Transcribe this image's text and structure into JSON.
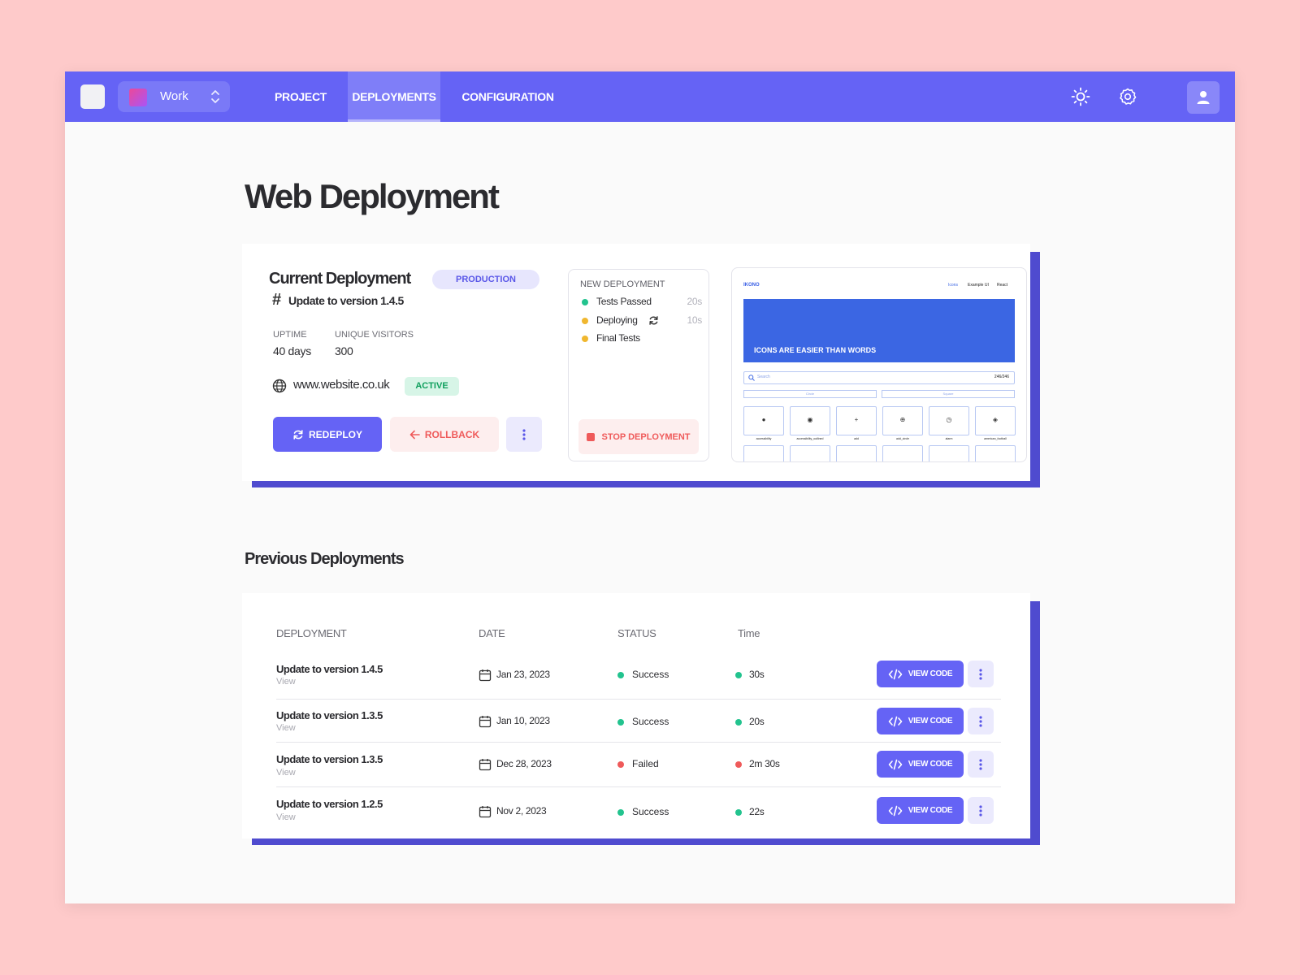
{
  "colors": {
    "accent": "#6563f5",
    "success": "#22c38e",
    "warning": "#f0b72f",
    "danger": "#ef5a5a",
    "background": "#fecaca"
  },
  "workspace": {
    "label": "Work"
  },
  "nav": {
    "tabs": [
      "PROJECT",
      "DEPLOYMENTS",
      "CONFIGURATION"
    ],
    "active": "DEPLOYMENTS"
  },
  "page_title": "Web Deployment",
  "current": {
    "title": "Current Deployment",
    "environment": "PRODUCTION",
    "version": "Update to version 1.4.5",
    "stats": [
      {
        "label": "UPTIME",
        "value": "40 days"
      },
      {
        "label": "UNIQUE VISITORS",
        "value": "300"
      }
    ],
    "url": "www.website.co.uk",
    "status": "ACTIVE",
    "buttons": {
      "redeploy": "REDEPLOY",
      "rollback": "ROLLBACK"
    }
  },
  "new_deployment": {
    "title": "NEW DEPLOYMENT",
    "steps": [
      {
        "label": "Tests Passed",
        "time": "20s",
        "state": "success"
      },
      {
        "label": "Deploying",
        "time": "10s",
        "state": "in-progress"
      },
      {
        "label": "Final Tests",
        "time": "",
        "state": "pending"
      }
    ],
    "stop_label": "STOP DEPLOYMENT"
  },
  "preview": {
    "brand": "IKONO",
    "nav": [
      "Icons",
      "Example UI",
      "React"
    ],
    "hero": "ICONS ARE EASIER THAN WORDS",
    "search_placeholder": "Search",
    "count": "246/246",
    "toggles": [
      "Circle",
      "Square"
    ],
    "tiles": [
      "accessibility",
      "accessibility_outlined",
      "add",
      "add_circle",
      "alarm",
      "american_football"
    ]
  },
  "previous": {
    "title": "Previous Deployments",
    "columns": [
      "DEPLOYMENT",
      "DATE",
      "STATUS",
      "Time"
    ],
    "view_code_label": "VIEW CODE",
    "rows": [
      {
        "name": "Update to version 1.4.5",
        "link": "View",
        "date": "Jan 23, 2023",
        "status": "Success",
        "time": "30s",
        "state": "success"
      },
      {
        "name": "Update to version 1.3.5",
        "link": "View",
        "date": "Jan 10, 2023",
        "status": "Success",
        "time": "20s",
        "state": "success"
      },
      {
        "name": "Update to version 1.3.5",
        "link": "View",
        "date": "Dec 28, 2023",
        "status": "Failed",
        "time": "2m 30s",
        "state": "failed"
      },
      {
        "name": "Update to version 1.2.5",
        "link": "View",
        "date": "Nov 2, 2023",
        "status": "Success",
        "time": "22s",
        "state": "success"
      }
    ]
  }
}
